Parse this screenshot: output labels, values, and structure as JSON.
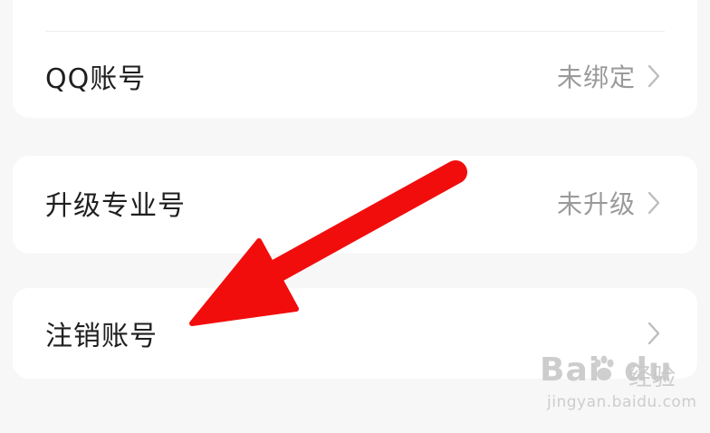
{
  "rows": {
    "partial": {
      "label": "",
      "value": ""
    },
    "qq": {
      "label": "QQ账号",
      "value": "未绑定"
    },
    "upgrade": {
      "label": "升级专业号",
      "value": "未升级"
    },
    "cancel": {
      "label": "注销账号",
      "value": ""
    }
  },
  "watermark": {
    "brand_left": "Bai",
    "brand_right": "du",
    "brand_cn": "经验",
    "url": "jingyan.baidu.com"
  },
  "colors": {
    "arrow": "#f20d0d",
    "label": "#1f1f1f",
    "value": "#9a9a9a",
    "background": "#f7f7f7",
    "card": "#ffffff"
  },
  "icons": {
    "chevron": "chevron-right-icon",
    "pointer": "red-arrow-annotation"
  }
}
